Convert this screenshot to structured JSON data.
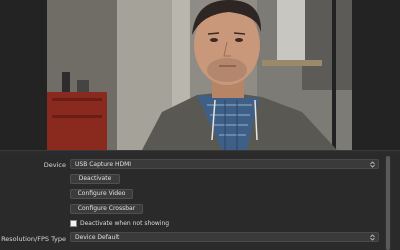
{
  "properties": {
    "device": {
      "label": "Device",
      "value": "USB Capture HDMI"
    },
    "buttons": {
      "deactivate": "Deactivate",
      "configure_video": "Configure Video",
      "configure_crossbar": "Configure Crossbar"
    },
    "deactivate_when_not_showing": {
      "label": "Deactivate when not showing",
      "checked": false
    },
    "resolution_fps_type": {
      "label": "Resolution/FPS Type",
      "value": "Device Default"
    }
  },
  "icons": {
    "combo_arrow": "up-down-chevron-icon"
  }
}
